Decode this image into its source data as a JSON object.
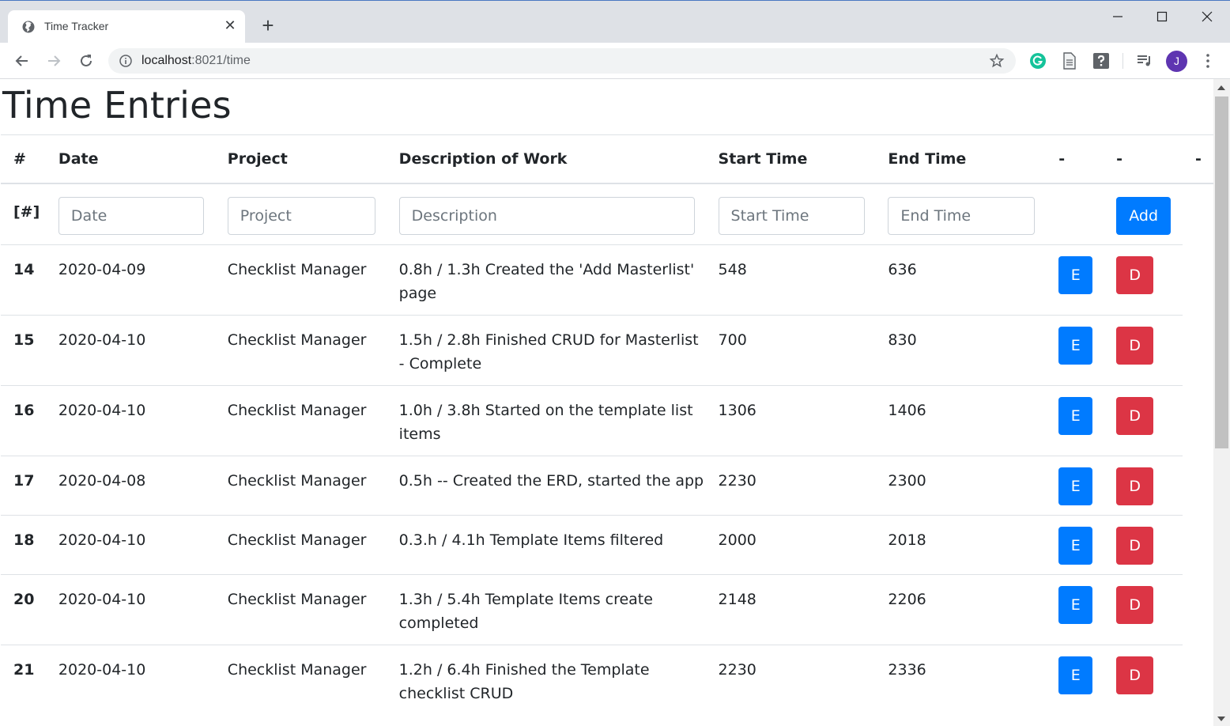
{
  "browser": {
    "tab_title": "Time Tracker",
    "url_host": "localhost",
    "url_path": ":8021/time",
    "avatar_initial": "J",
    "new_tab_glyph": "+",
    "close_tab_glyph": "✕"
  },
  "page": {
    "title": "Time Entries"
  },
  "table": {
    "headers": [
      "#",
      "Date",
      "Project",
      "Description of Work",
      "Start Time",
      "End Time",
      "-",
      "-",
      "-"
    ],
    "form": {
      "id_label": "[#]",
      "date_placeholder": "Date",
      "project_placeholder": "Project",
      "description_placeholder": "Description",
      "start_placeholder": "Start Time",
      "end_placeholder": "End Time",
      "add_label": "Add"
    },
    "edit_label": "E",
    "delete_label": "D",
    "rows": [
      {
        "id": "14",
        "date": "2020-04-09",
        "project": "Checklist Manager",
        "description": "0.8h / 1.3h Created the 'Add Masterlist' page",
        "start": "548",
        "end": "636"
      },
      {
        "id": "15",
        "date": "2020-04-10",
        "project": "Checklist Manager",
        "description": "1.5h / 2.8h Finished CRUD for Masterlist - Complete",
        "start": "700",
        "end": "830"
      },
      {
        "id": "16",
        "date": "2020-04-10",
        "project": "Checklist Manager",
        "description": "1.0h / 3.8h Started on the template list items",
        "start": "1306",
        "end": "1406"
      },
      {
        "id": "17",
        "date": "2020-04-08",
        "project": "Checklist Manager",
        "description": "0.5h -- Created the ERD, started the app",
        "start": "2230",
        "end": "2300"
      },
      {
        "id": "18",
        "date": "2020-04-10",
        "project": "Checklist Manager",
        "description": "0.3.h / 4.1h Template Items filtered",
        "start": "2000",
        "end": "2018"
      },
      {
        "id": "20",
        "date": "2020-04-10",
        "project": "Checklist Manager",
        "description": "1.3h / 5.4h Template Items create completed",
        "start": "2148",
        "end": "2206"
      },
      {
        "id": "21",
        "date": "2020-04-10",
        "project": "Checklist Manager",
        "description": "1.2h / 6.4h Finished the Template checklist CRUD",
        "start": "2230",
        "end": "2336"
      }
    ]
  },
  "colors": {
    "primary": "#007bff",
    "danger": "#dc3545",
    "avatar": "#5e35b1"
  }
}
